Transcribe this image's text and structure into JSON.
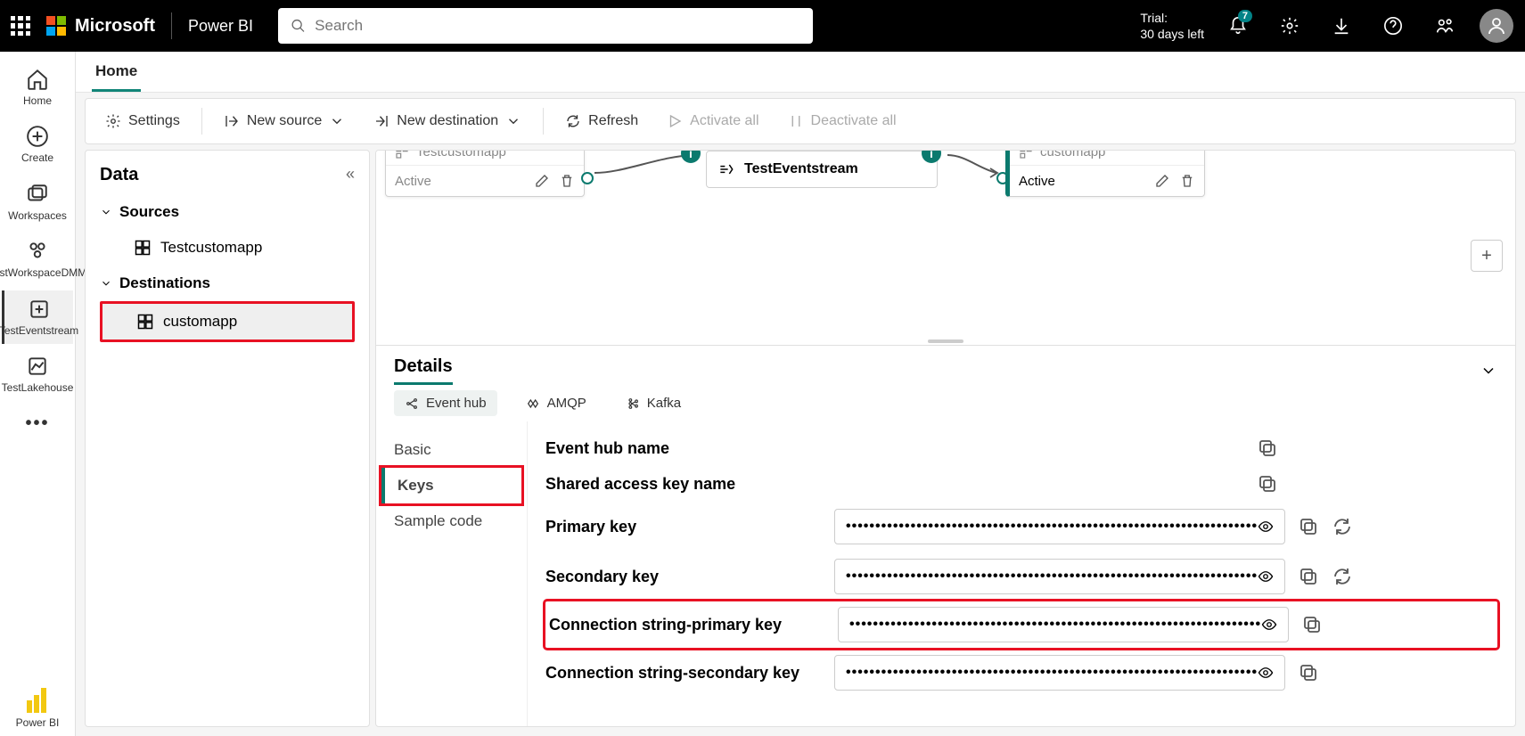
{
  "header": {
    "brand": "Microsoft",
    "product": "Power BI",
    "search_placeholder": "Search",
    "trial_line1": "Trial:",
    "trial_line2": "30 days left",
    "notification_count": "7"
  },
  "navrail": {
    "home": "Home",
    "create": "Create",
    "workspaces": "Workspaces",
    "testworkspace": "TestWorkspaceDMM",
    "eventstream": "TestEventstream",
    "lakehouse": "TestLakehouse",
    "powerbi": "Power BI"
  },
  "tabs": {
    "home": "Home"
  },
  "toolbar": {
    "settings": "Settings",
    "new_source": "New source",
    "new_destination": "New destination",
    "refresh": "Refresh",
    "activate_all": "Activate all",
    "deactivate_all": "Deactivate all"
  },
  "datapanel": {
    "title": "Data",
    "sources_label": "Sources",
    "source1": "Testcustomapp",
    "destinations_label": "Destinations",
    "dest1": "customapp"
  },
  "canvas": {
    "source_name": "Testcustomapp",
    "source_status": "Active",
    "stream_name": "TestEventstream",
    "dest_name": "customapp",
    "dest_status": "Active"
  },
  "details": {
    "title": "Details",
    "proto_eventhub": "Event hub",
    "proto_amqp": "AMQP",
    "proto_kafka": "Kafka",
    "side_basic": "Basic",
    "side_keys": "Keys",
    "side_sample": "Sample code",
    "row1": "Event hub name",
    "row2": "Shared access key name",
    "row3": "Primary key",
    "row4": "Secondary key",
    "row5": "Connection string-primary key",
    "row6": "Connection string-secondary key",
    "masked": "••••••••••••••••••••••••••••••••••••••••••••••••••••••••••••••••••••••"
  }
}
